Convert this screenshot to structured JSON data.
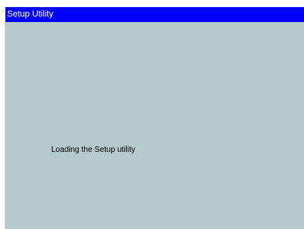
{
  "window": {
    "title": "Setup Utility"
  },
  "main": {
    "status_text": "Loading the Setup utility"
  },
  "colors": {
    "titlebar": "#0000ff",
    "title_text": "#ffffff",
    "background": "#b4cacb",
    "status_text": "#000000"
  }
}
